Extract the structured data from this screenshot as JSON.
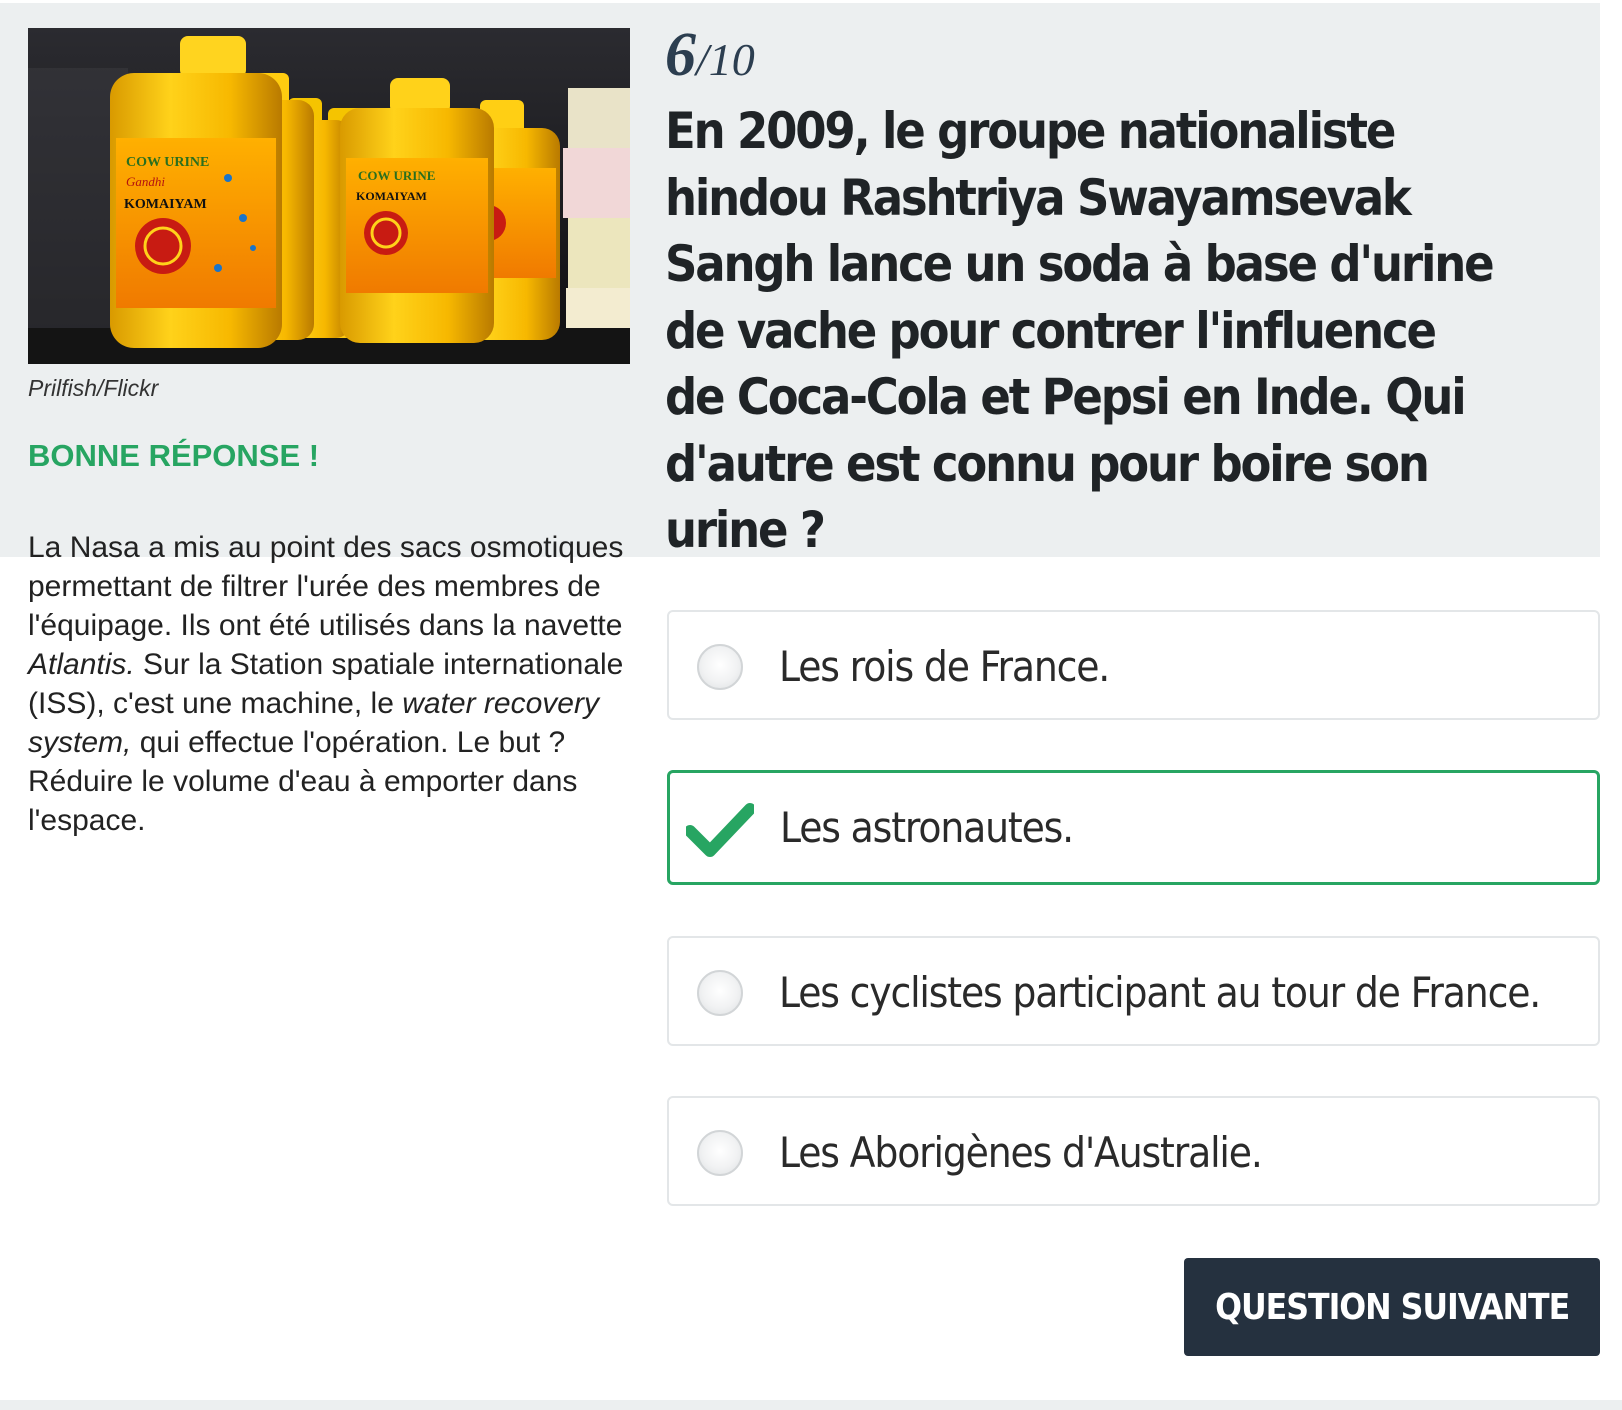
{
  "colors": {
    "accent_correct": "#27a562",
    "button_bg": "#25313f",
    "band_bg": "#eceff0"
  },
  "media": {
    "photo_icon": "cow-urine-bottles-photo",
    "credit": "Prilfish/Flickr"
  },
  "result": {
    "verdict": "BONNE RÉPONSE !",
    "explanation": {
      "part1": "La Nasa a mis au point des sacs osmotiques permettant de filtrer l'urée des membres de l'équipage. Ils ont été utilisés dans la navette ",
      "em1": "Atlantis.",
      "part2": " Sur la Station spatiale internationale (ISS), c'est une machine, le ",
      "em2": "water recovery system,",
      "part3": " qui effectue l'opération. Le but ? Réduire le volume d'eau à emporter dans l'espace."
    }
  },
  "quiz": {
    "current": "6",
    "separator": "/",
    "total": "10",
    "question": "En 2009, le groupe nationaliste hindou Rashtriya Swayamsevak Sangh lance un soda à base d'urine de vache pour contrer l'influence de Coca-Cola et Pepsi en Inde. Qui d'autre est connu pour boire son urine ?",
    "answers": [
      {
        "label": "Les rois de France.",
        "state": "unselected",
        "icon": "radio-icon"
      },
      {
        "label": "Les astronautes.",
        "state": "correct",
        "icon": "checkmark-icon"
      },
      {
        "label": "Les cyclistes participant au tour de France.",
        "state": "unselected",
        "icon": "radio-icon"
      },
      {
        "label": "Les Aborigènes d'Australie.",
        "state": "unselected",
        "icon": "radio-icon"
      }
    ],
    "next_label": "QUESTION SUIVANTE"
  }
}
